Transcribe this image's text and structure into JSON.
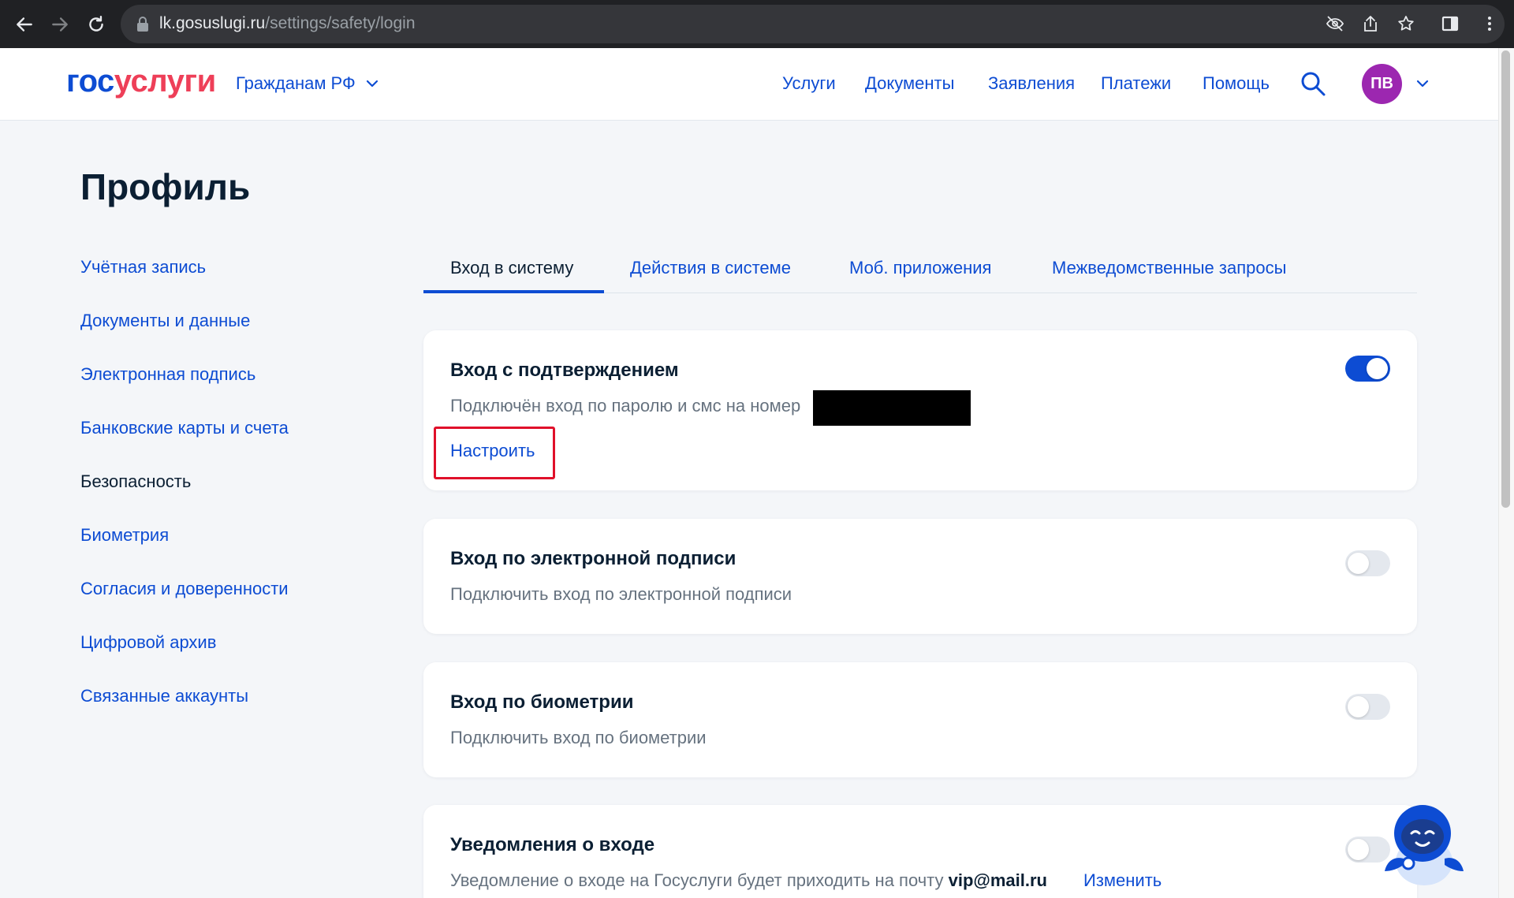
{
  "browser": {
    "url_host": "lk.gosuslugi.ru",
    "url_path": "/settings/safety/login"
  },
  "header": {
    "logo_part1": "гос",
    "logo_part2": "услуги",
    "citizen_menu": "Гражданам РФ",
    "nav": [
      "Услуги",
      "Документы",
      "Заявления",
      "Платежи",
      "Помощь"
    ],
    "avatar_initials": "ПВ"
  },
  "page": {
    "title": "Профиль"
  },
  "sidebar": {
    "items": [
      {
        "label": "Учётная запись"
      },
      {
        "label": "Документы и данные"
      },
      {
        "label": "Электронная подпись"
      },
      {
        "label": "Банковские карты и счета"
      },
      {
        "label": "Безопасность"
      },
      {
        "label": "Биометрия"
      },
      {
        "label": "Согласия и доверенности"
      },
      {
        "label": "Цифровой архив"
      },
      {
        "label": "Связанные аккаунты"
      }
    ],
    "active": "Безопасность"
  },
  "tabs": {
    "items": [
      "Вход в систему",
      "Действия в системе",
      "Моб. приложения",
      "Межведомственные запросы"
    ],
    "active": "Вход в систему"
  },
  "cards": [
    {
      "title": "Вход с подтверждением",
      "description": "Подключён вход по паролю и смс на номер",
      "action": "Настроить",
      "enabled": true
    },
    {
      "title": "Вход по электронной подписи",
      "description": "Подключить вход по электронной подписи",
      "enabled": false
    },
    {
      "title": "Вход по биометрии",
      "description": "Подключить вход по биометрии",
      "enabled": false
    },
    {
      "title": "Уведомления о входе",
      "description": "Уведомление о входе на Госуслуги будет приходить на почту",
      "email": "vip@mail.ru",
      "action": "Изменить",
      "enabled": false
    }
  ],
  "colors": {
    "brand_blue": "#0d4cd3",
    "brand_red": "#ee3f58",
    "avatar": "#9c27b0",
    "highlight": "#e0102a"
  }
}
